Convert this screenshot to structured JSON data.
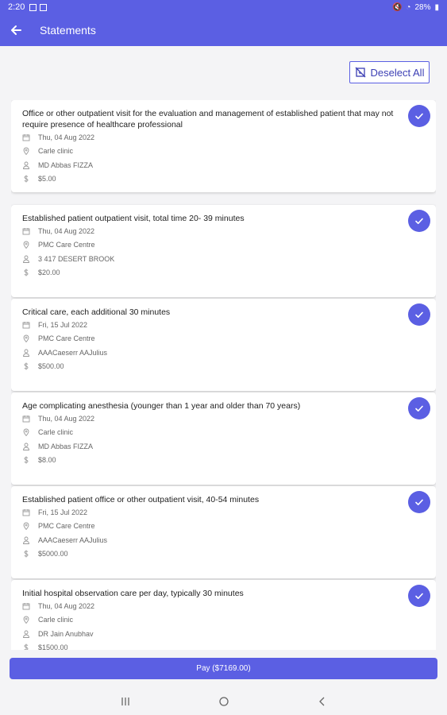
{
  "status_bar": {
    "time": "2:20",
    "battery": "28%"
  },
  "header": {
    "title": "Statements"
  },
  "deselect_all": {
    "label": "Deselect All"
  },
  "statements": [
    {
      "title": "Office or other outpatient visit for the evaluation and management of established patient that may not require presence of healthcare professional",
      "date": "Thu, 04 Aug 2022",
      "location": "Carle clinic",
      "provider": "MD Abbas FIZZA",
      "amount": "$5.00",
      "selected": true
    },
    {
      "title": "Established patient outpatient visit, total time 20- 39 minutes",
      "date": "Thu, 04 Aug 2022",
      "location": "PMC Care Centre",
      "provider": "3 417 DESERT BROOK",
      "amount": "$20.00",
      "selected": true
    },
    {
      "title": "Critical care, each additional 30 minutes",
      "date": "Fri, 15 Jul 2022",
      "location": "PMC Care Centre",
      "provider": "AAACaeserr AAJulius",
      "amount": "$500.00",
      "selected": true
    },
    {
      "title": "Age complicating anesthesia (younger than 1 year and older than 70 years)",
      "date": "Thu, 04 Aug 2022",
      "location": "Carle clinic",
      "provider": "MD Abbas FIZZA",
      "amount": "$8.00",
      "selected": true
    },
    {
      "title": "Established patient office or other outpatient visit, 40-54 minutes",
      "date": "Fri, 15 Jul 2022",
      "location": "PMC Care Centre",
      "provider": "AAACaeserr AAJulius",
      "amount": "$5000.00",
      "selected": true
    },
    {
      "title": "Initial hospital observation care per day, typically 30 minutes",
      "date": "Thu, 04 Aug 2022",
      "location": "Carle clinic",
      "provider": "DR Jain Anubhav",
      "amount": "$1500.00",
      "selected": true
    }
  ],
  "pay_button": {
    "label": "Pay ($7169.00)"
  },
  "colors": {
    "primary": "#5b5fe3",
    "background": "#f4f4f6",
    "card": "#ffffff"
  },
  "icons": {
    "date": "calendar-icon",
    "location": "location-pin-icon",
    "provider": "person-icon",
    "amount": "dollar-icon",
    "selected": "check-icon"
  }
}
